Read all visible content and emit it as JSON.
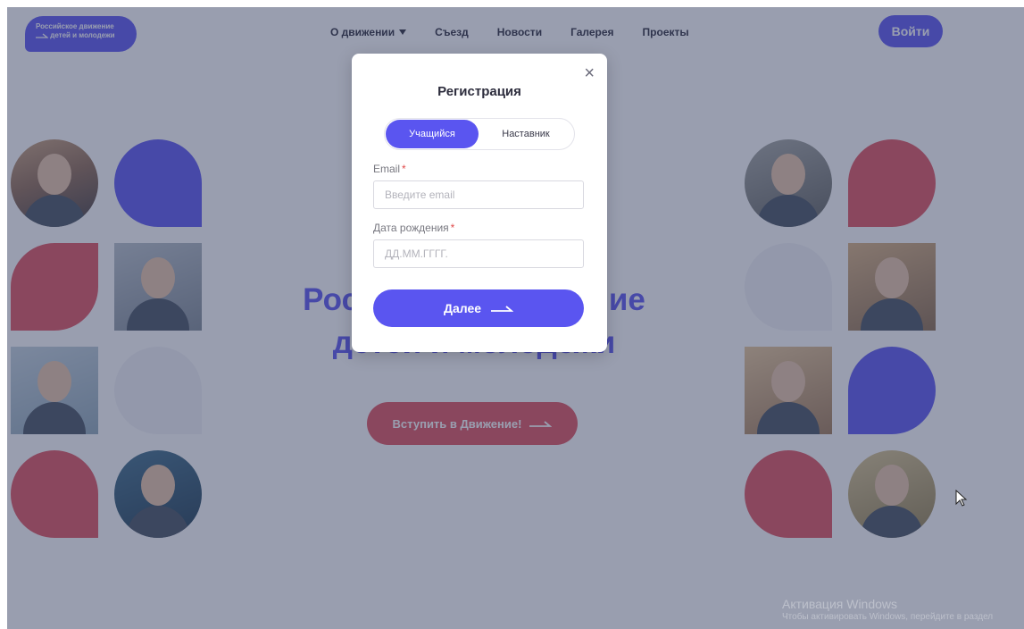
{
  "colors": {
    "accent": "#5a55f0",
    "red": "#e0505c",
    "gray_tile": "#f2f3f6"
  },
  "header": {
    "logo_line1": "Российское движение",
    "logo_line2": "детей и молодежи",
    "nav": [
      "О движении",
      "Съезд",
      "Новости",
      "Галерея",
      "Проекты"
    ],
    "login_label": "Войти"
  },
  "hero": {
    "line1": "Российское движение",
    "line2": "детей и молодежи",
    "join_label": "Вступить в Движение!"
  },
  "modal": {
    "title": "Регистрация",
    "tabs": [
      {
        "label": "Учащийся",
        "active": true
      },
      {
        "label": "Наставник",
        "active": false
      }
    ],
    "email": {
      "label": "Email",
      "required_mark": "*",
      "placeholder": "Введите email"
    },
    "birth": {
      "label": "Дата рождения",
      "required_mark": "*",
      "placeholder": "ДД.ММ.ГГГГ."
    },
    "next_label": "Далее",
    "close_glyph": "×"
  },
  "watermark": {
    "line1": "Активация Windows",
    "line2": "Чтобы активировать Windows, перейдите в раздел"
  },
  "icons": [
    "close-icon",
    "arrow-right-icon",
    "chevron-down-icon",
    "mouse-cursor-icon"
  ]
}
